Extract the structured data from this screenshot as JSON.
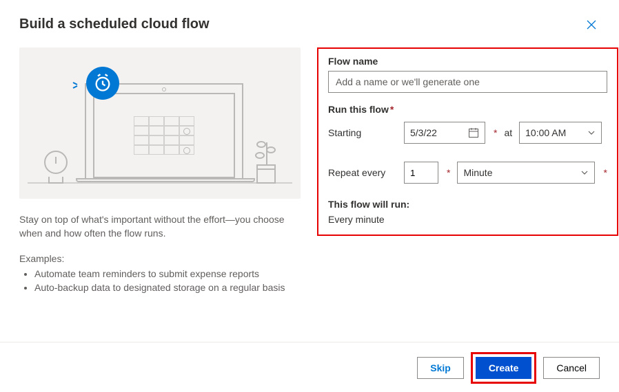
{
  "dialog": {
    "title": "Build a scheduled cloud flow",
    "description": "Stay on top of what's important without the effort—you choose when and how often the flow runs.",
    "examples_heading": "Examples:",
    "examples": [
      "Automate team reminders to submit expense reports",
      "Auto-backup data to designated storage on a regular basis"
    ]
  },
  "form": {
    "flow_name_label": "Flow name",
    "flow_name_placeholder": "Add a name or we'll generate one",
    "flow_name_value": "",
    "run_section_label": "Run this flow",
    "starting_label": "Starting",
    "starting_date": "5/3/22",
    "at_label": "at",
    "starting_time": "10:00 AM",
    "repeat_label": "Repeat every",
    "repeat_value": "1",
    "repeat_unit": "Minute",
    "runs_heading": "This flow will run:",
    "runs_text": "Every minute"
  },
  "footer": {
    "skip_label": "Skip",
    "create_label": "Create",
    "cancel_label": "Cancel"
  },
  "colors": {
    "brand": "#0078d4",
    "highlight": "#e60000",
    "primary_button": "#0050cf"
  }
}
